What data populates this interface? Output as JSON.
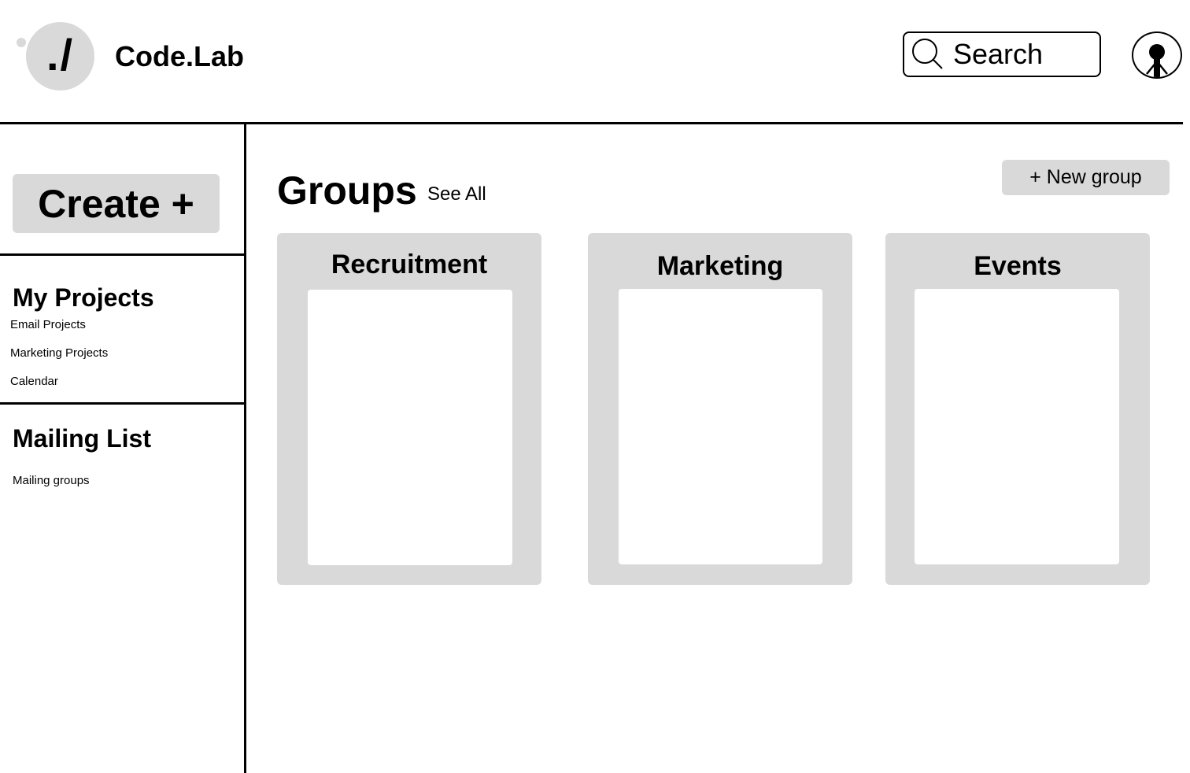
{
  "header": {
    "logo_mark": "./",
    "brand": "Code.Lab",
    "search": {
      "placeholder": "Search"
    }
  },
  "sidebar": {
    "create_label": "Create +",
    "my_projects": {
      "title": "My Projects",
      "items": [
        "Email Projects",
        "Marketing Projects",
        "Calendar"
      ]
    },
    "mailing_list": {
      "title": "Mailing List",
      "items": [
        "Mailing groups"
      ]
    }
  },
  "main": {
    "title": "Groups",
    "see_all": "See All",
    "new_group": "+ New group",
    "groups": [
      {
        "title": "Recruitment"
      },
      {
        "title": "Marketing"
      },
      {
        "title": "Events"
      }
    ]
  },
  "colors": {
    "panel": "#d9d9d9",
    "background": "#ffffff",
    "rule": "#000000"
  }
}
